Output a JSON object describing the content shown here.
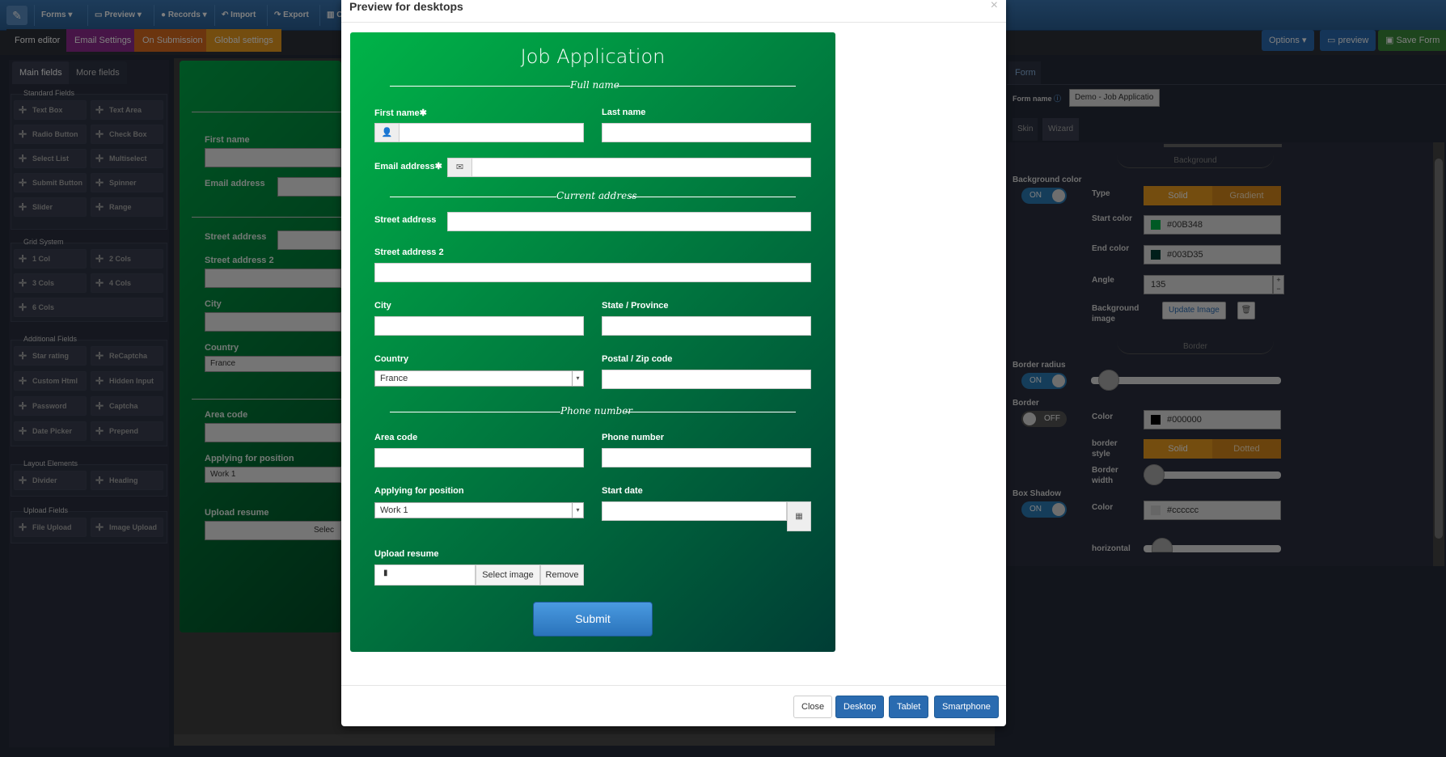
{
  "topnav": {
    "items": [
      "Forms",
      "Preview",
      "Records",
      "Import",
      "Export",
      "C"
    ]
  },
  "subnav": {
    "tabs": [
      "Form editor",
      "Email Settings",
      "On Submission",
      "Global settings"
    ],
    "options_label": "Options",
    "preview_label": "preview",
    "save_label": "Save Form"
  },
  "leftpanel": {
    "tabs": [
      "Main fields",
      "More fields"
    ],
    "standard_title": "Standard Fields",
    "standard": [
      "Text Box",
      "Text Area",
      "Radio Button",
      "Check Box",
      "Select List",
      "Multiselect",
      "Submit Button",
      "Spinner",
      "Slider",
      "Range"
    ],
    "grid_title": "Grid System",
    "grid": [
      "1 Col",
      "2 Cols",
      "3 Cols",
      "4 Cols",
      "6 Cols"
    ],
    "additional_title": "Additional Fields",
    "additional": [
      "Star rating",
      "ReCaptcha",
      "Custom Html",
      "Hidden Input",
      "Password",
      "Captcha",
      "Date Picker",
      "Prepend"
    ],
    "layout_title": "Layout Elements",
    "layout": [
      "Divider",
      "Heading"
    ],
    "upload_title": "Upload Fields",
    "upload": [
      "File Upload",
      "Image Upload"
    ]
  },
  "bgform": {
    "first_name": "First name",
    "email": "Email address",
    "street": "Street address",
    "street2": "Street address 2",
    "city": "City",
    "country": "Country",
    "country_value": "France",
    "area_code": "Area code",
    "applying": "Applying for position",
    "applying_value": "Work 1",
    "upload": "Upload resume",
    "select_partial": "Selec"
  },
  "rightpanel": {
    "tab": "Form",
    "form_name_label": "Form name",
    "form_name_value": "Demo - Job Applicatio",
    "skin_tab": "Skin",
    "wizard_tab": "Wizard",
    "background_section": "Background",
    "bg_color_label": "Background color",
    "bg_toggle": "ON",
    "type_label": "Type",
    "type_solid": "Solid",
    "type_gradient": "Gradient",
    "start_color_label": "Start color",
    "start_color": "#00B348",
    "end_color_label": "End color",
    "end_color": "#003D35",
    "angle_label": "Angle",
    "angle_value": "135",
    "bg_image_label": "Background image",
    "update_image": "Update Image",
    "border_section": "Border",
    "border_radius_label": "Border radius",
    "border_radius_toggle": "ON",
    "border_label": "Border",
    "border_toggle": "OFF",
    "border_color_label": "Color",
    "border_color": "#000000",
    "border_style_label": "border style",
    "style_solid": "Solid",
    "style_dotted": "Dotted",
    "border_width_label": "Border width",
    "box_shadow_label": "Box Shadow",
    "box_shadow_toggle": "ON",
    "shadow_color_label": "Color",
    "shadow_color": "#cccccc",
    "horizontal_label": "horizontal"
  },
  "modal": {
    "title": "Preview for desktops",
    "close_x": "×",
    "buttons": {
      "close": "Close",
      "desktop": "Desktop",
      "tablet": "Tablet",
      "smartphone": "Smartphone"
    }
  },
  "jobform": {
    "title": "Job Application",
    "section_fullname": "Full name",
    "first_name": "First name",
    "last_name": "Last name",
    "email": "Email address",
    "section_address": "Current address",
    "street": "Street address",
    "street2": "Street address 2",
    "city": "City",
    "state": "State / Province",
    "country": "Country",
    "country_value": "France",
    "postal": "Postal / Zip code",
    "section_phone": "Phone number",
    "area_code": "Area code",
    "phone": "Phone number",
    "applying": "Applying for position",
    "applying_value": "Work 1",
    "start_date": "Start date",
    "upload": "Upload resume",
    "select_image": "Select image",
    "remove": "Remove",
    "submit": "Submit",
    "required_mark": "✱"
  },
  "colors": {
    "gradient_start": "#00B348",
    "gradient_end": "#003D35",
    "topbar": "#2a5f94",
    "email_tab": "#8e2a8e",
    "submission_tab": "#d96a1f",
    "global_tab": "#e89a1f",
    "save_btn": "#3a8a3a"
  }
}
